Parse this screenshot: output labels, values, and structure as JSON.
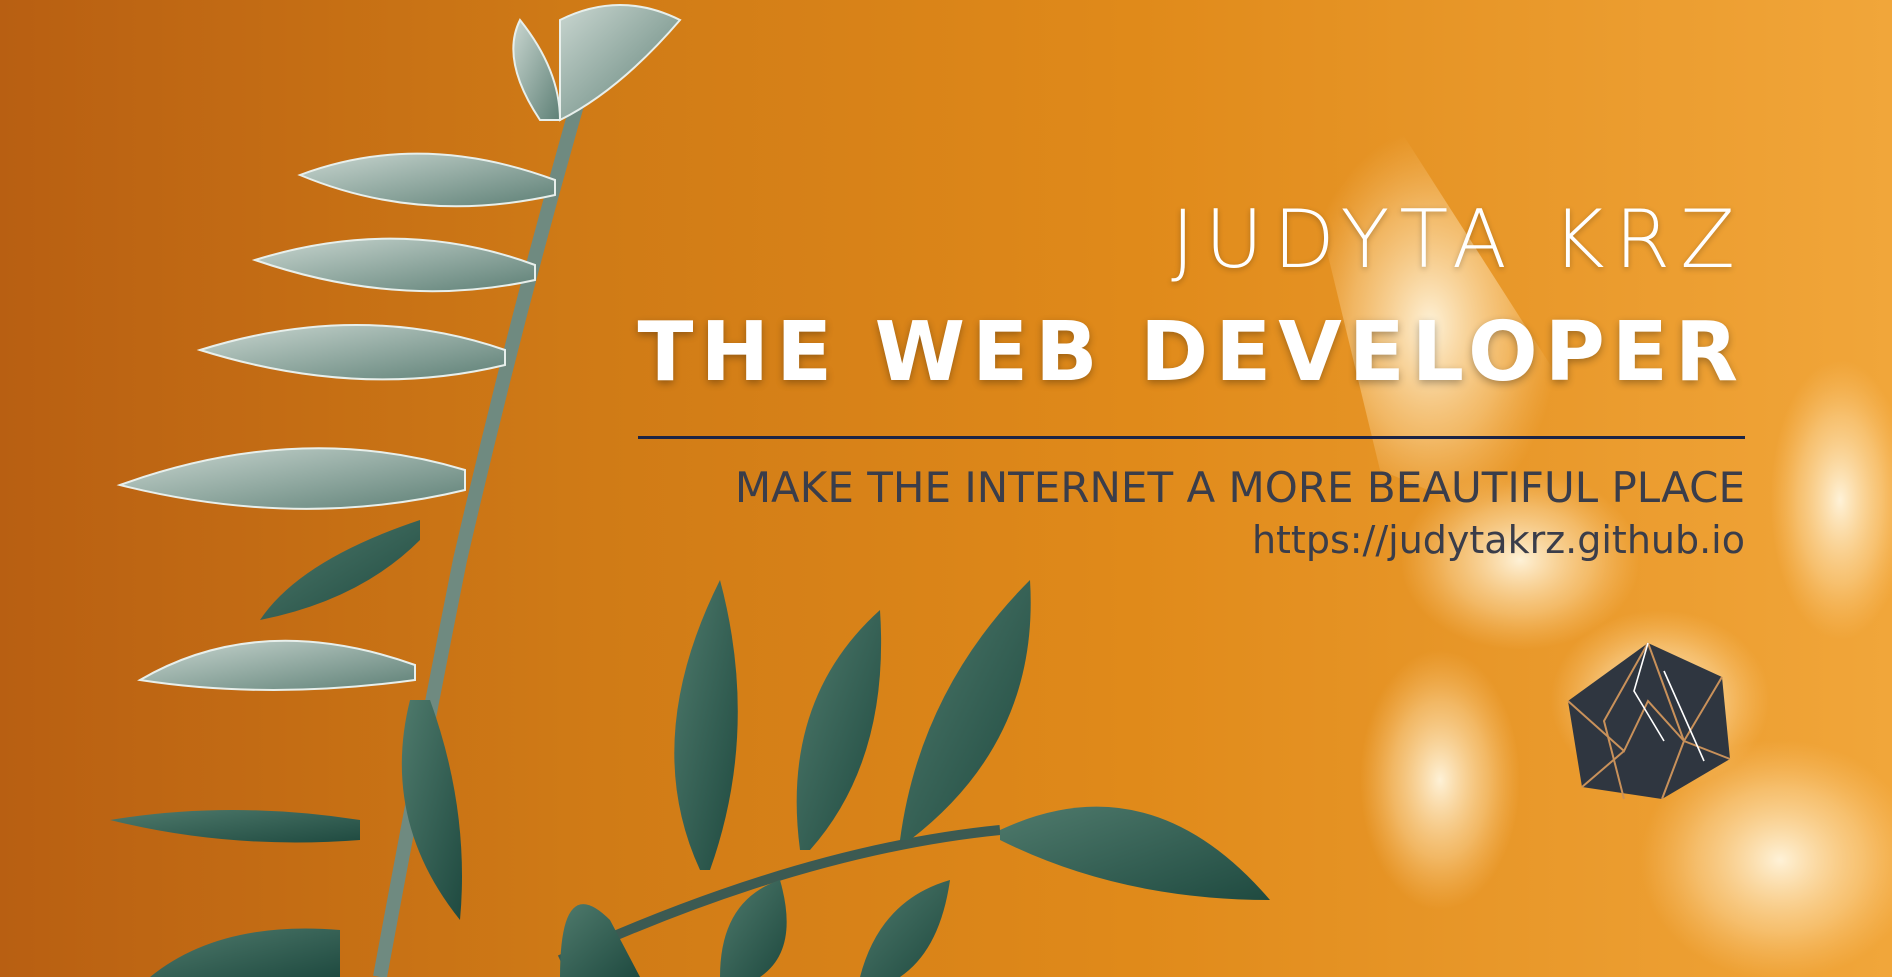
{
  "hero": {
    "name": "JUDYTA KRZ",
    "role": "THE WEB DEVELOPER",
    "tagline": "MAKE THE INTERNET A MORE BEAUTIFUL PLACE",
    "url": "https://judytakrz.github.io"
  },
  "icons": {
    "logo": "hexagon-logo-icon",
    "background": "plant-leaves-photo"
  },
  "colors": {
    "background": "#d9821a",
    "heading": "#ffffff",
    "divider": "#1c2445",
    "subtext": "#3a3d4a",
    "logo_fill": "#2f3640",
    "logo_lines": "#c9915a",
    "leaf": "#5b7a70"
  }
}
